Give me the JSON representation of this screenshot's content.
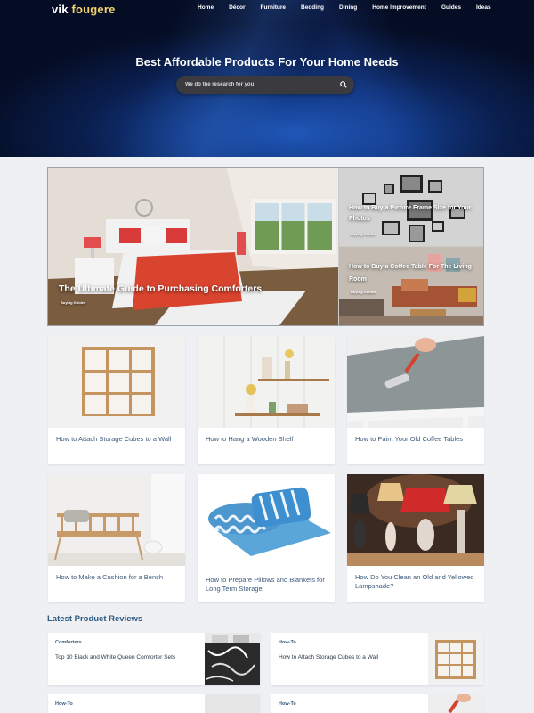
{
  "brand": {
    "name_part1": "vik",
    "name_part2": "fougere"
  },
  "nav": [
    "Home",
    "Décor",
    "Furniture",
    "Bedding",
    "Dining",
    "Home Improvement",
    "Guides",
    "Ideas"
  ],
  "hero": {
    "title": "Best Affordable Products For Your Home Needs",
    "search_placeholder": "We do the research for you"
  },
  "featured": {
    "main": {
      "title": "The Ultimate Guide to Purchasing Comforters",
      "tag": "Buying Guides"
    },
    "side1": {
      "title": "How to Buy a Picture Frame Size for Your Photos",
      "tag": "Buying Guides"
    },
    "side2": {
      "title": "How to Buy a Coffee Table For The Living Room",
      "tag": "Buying Guides"
    }
  },
  "cards": [
    {
      "title": "How to Attach Storage Cubes to a Wall"
    },
    {
      "title": "How to Hang a Wooden Shelf"
    },
    {
      "title": "How to Paint Your Old Coffee Tables"
    },
    {
      "title": "How to Make a Cushion for a Bench"
    },
    {
      "title": "How to Prepare Pillows and Blankets for Long Term Storage"
    },
    {
      "title": "How Do You Clean an Old and Yellowed Lampshade?"
    }
  ],
  "latest_reviews": {
    "heading": "Latest Product Reviews",
    "items": [
      {
        "category": "Comforters",
        "title": "Top 10 Black and White Queen Comforter Sets"
      },
      {
        "category": "How-To",
        "title": "How to Attach Storage Cubes to a Wall"
      },
      {
        "category": "How-To",
        "title": ""
      },
      {
        "category": "How-To",
        "title": ""
      }
    ]
  },
  "colors": {
    "accent": "#f3d26a",
    "link": "#3c5a7c",
    "heading": "#2f5a80",
    "hero_bg": "#0a1f4f"
  }
}
